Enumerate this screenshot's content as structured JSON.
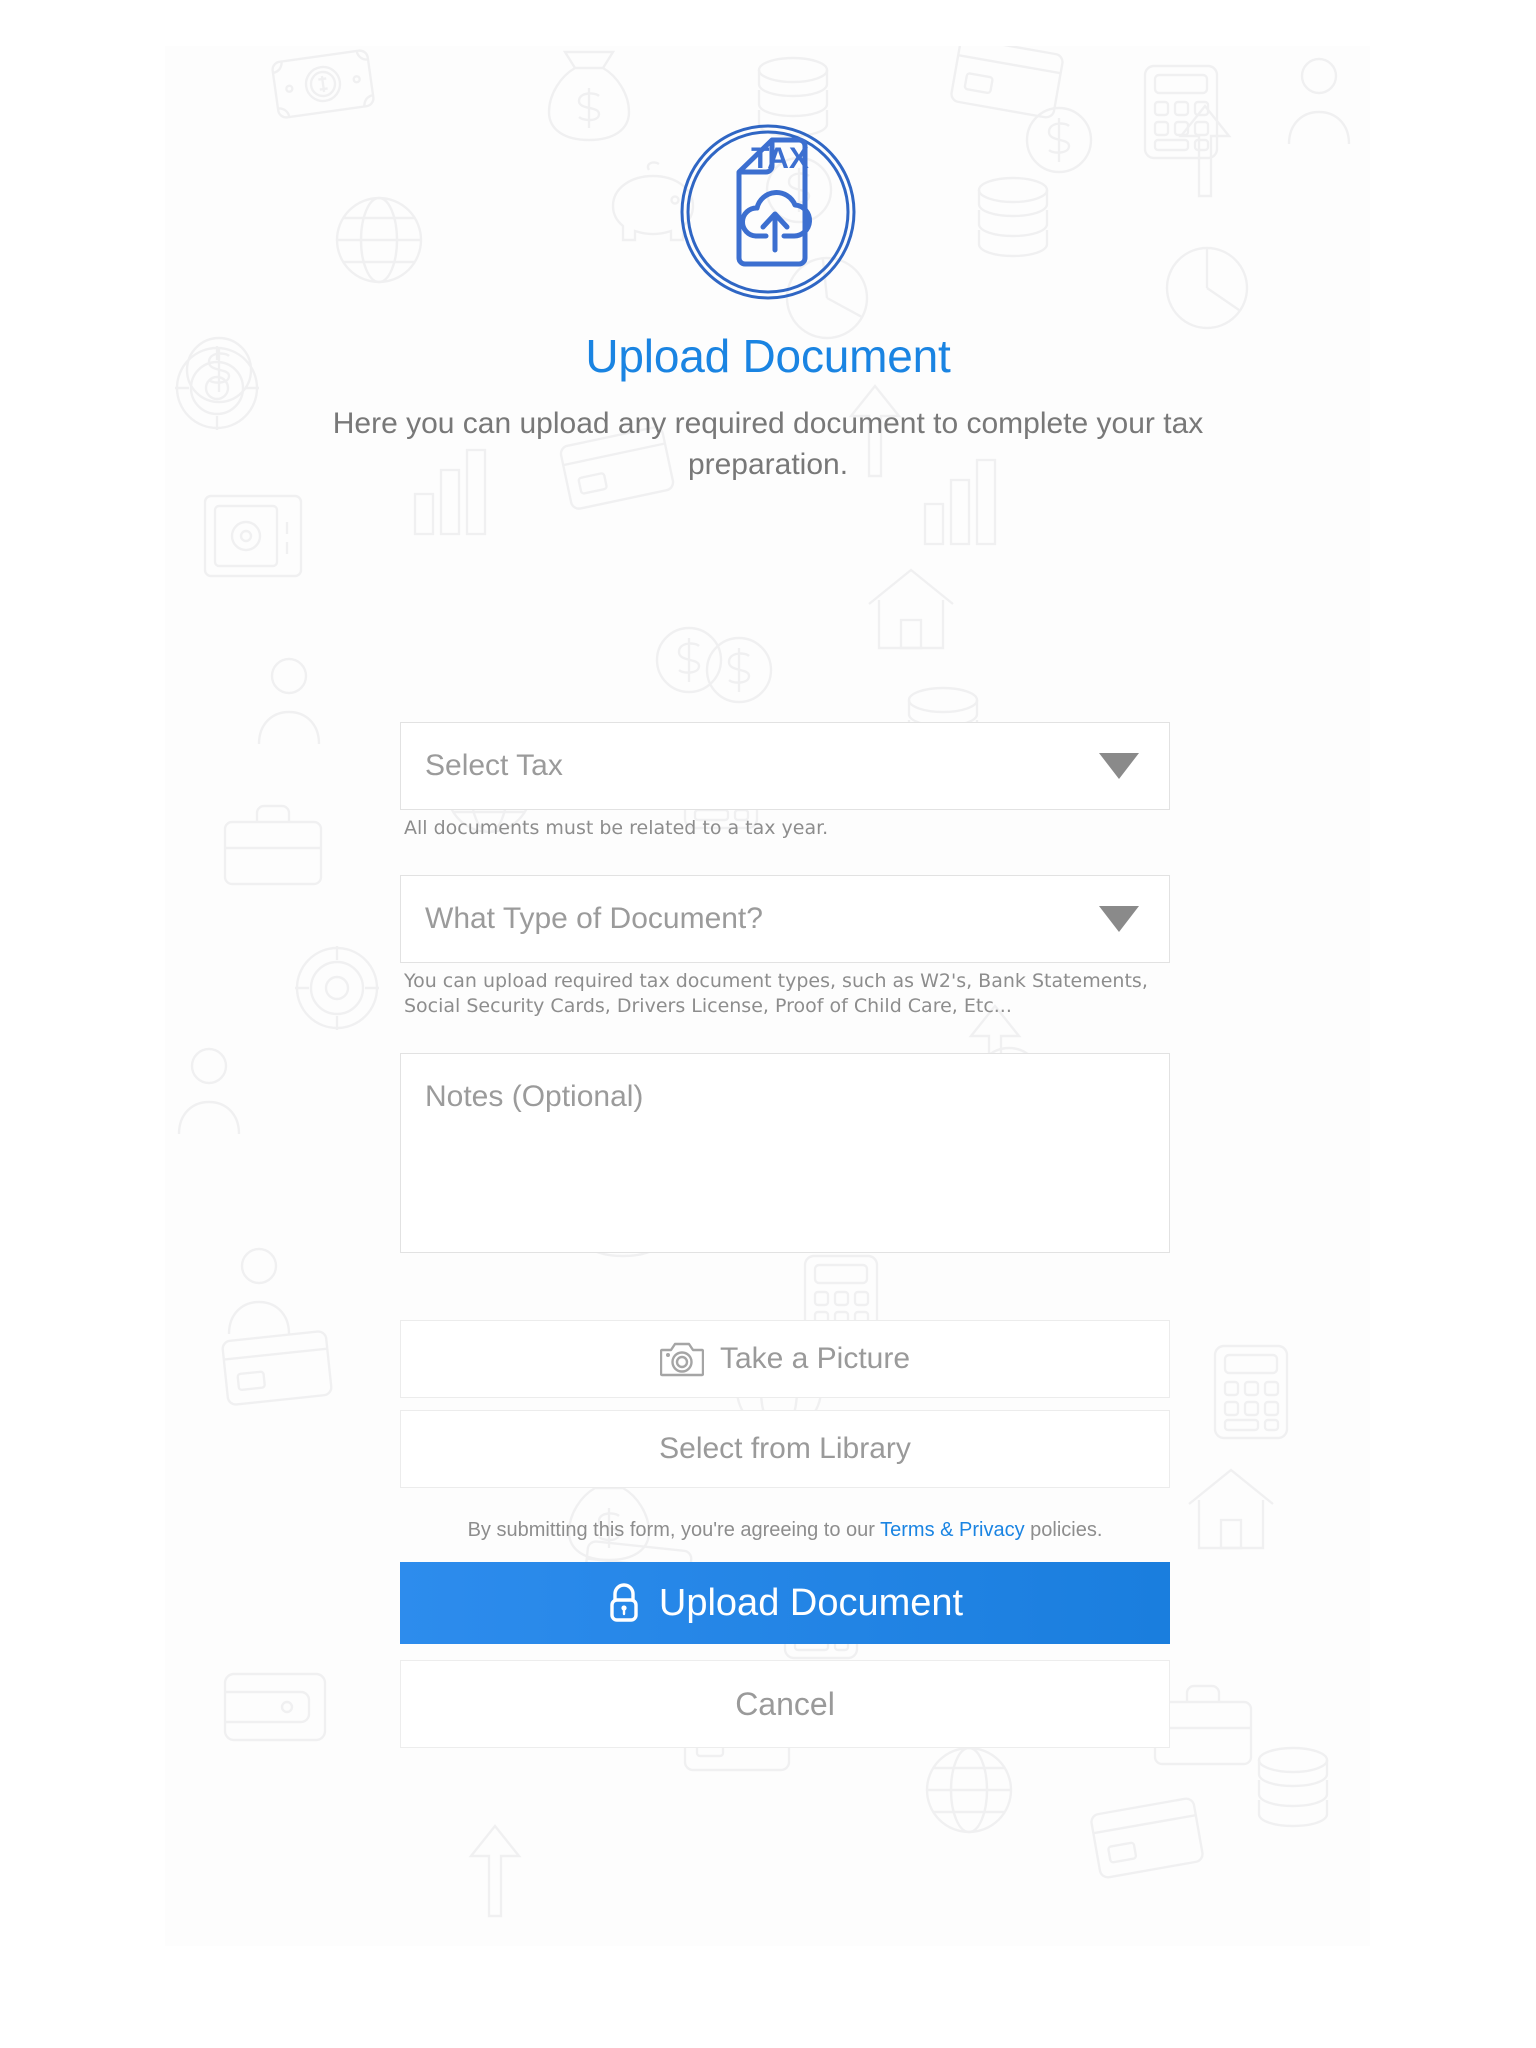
{
  "screen": {
    "title": "Upload Document",
    "subtitle": "Here you can upload any required document to complete your tax preparation."
  },
  "colors": {
    "accent": "#1a84e2",
    "button_blue_start": "#2d8ced",
    "button_blue_end": "#1a7ede",
    "body_text": "#787878",
    "placeholder": "#9b9b9b",
    "helper_text": "#8d8d8d",
    "field_border": "#e2e2e2"
  },
  "logo": {
    "name": "tax-document-upload-logo",
    "label": "TAX"
  },
  "form": {
    "tax_select": {
      "value": "Select Tax",
      "helper": "All documents must be related to a tax year."
    },
    "doc_type_select": {
      "value": "What Type of Document?",
      "helper": "You can upload required tax document types, such as W2's, Bank Statements, Social Security Cards, Drivers License, Proof of Child Care, Etc..."
    },
    "notes": {
      "value": "",
      "placeholder": "Notes (Optional)"
    },
    "take_picture_label": "Take a Picture",
    "select_library_label": "Select from Library"
  },
  "terms": {
    "prefix": "By submitting this form, you're agreeing to our ",
    "link": "Terms & Privacy",
    "suffix": " policies."
  },
  "actions": {
    "submit_label": "Upload Document",
    "cancel_label": "Cancel"
  },
  "background": {
    "pattern_icons": [
      "banknote-icon",
      "globe-icon",
      "coin-dollar-icon",
      "briefcase-icon",
      "piggy-bank-icon",
      "pie-chart-icon",
      "house-icon",
      "safe-icon",
      "calculator-icon",
      "wallet-icon",
      "person-icon",
      "target-icon",
      "bar-chart-icon",
      "arrow-up-icon",
      "money-bag-icon",
      "coins-stack-icon"
    ]
  }
}
